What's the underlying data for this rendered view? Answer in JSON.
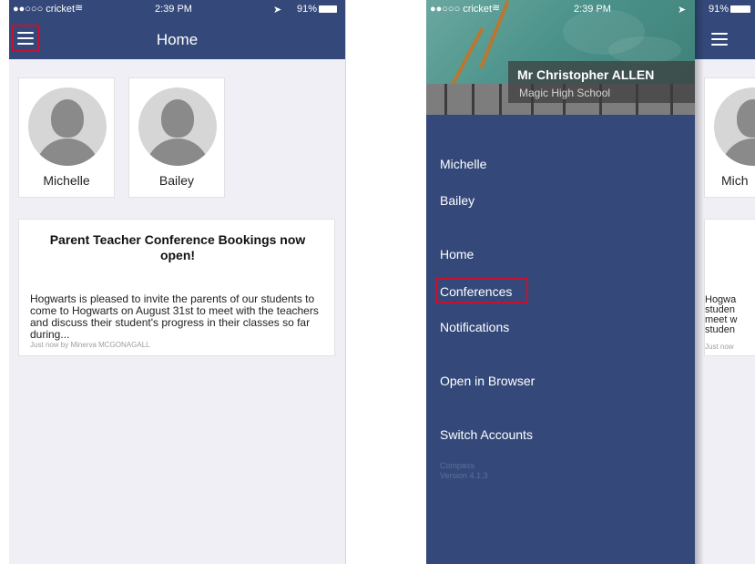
{
  "home_screen": {
    "status": {
      "carrier": "●●○○○ cricket",
      "time": "2:39 PM",
      "battery": "91%"
    },
    "nav_title": "Home",
    "students": [
      {
        "name": "Michelle"
      },
      {
        "name": "Bailey"
      }
    ],
    "news": {
      "title": "Parent Teacher Conference Bookings now open!",
      "body": "Hogwarts is pleased to invite the parents of our students to come to Hogwarts on August 31st to meet with the teachers and discuss their student's progress in their classes so far during...",
      "meta": "Just now by Minerva MCGONAGALL"
    }
  },
  "drawer_screen": {
    "status": {
      "carrier": "●●○○○ cricket",
      "time": "2:39 PM",
      "battery": "91%"
    },
    "profile": {
      "name": "Mr Christopher ALLEN",
      "school": "Magic High School"
    },
    "students": [
      "Michelle",
      "Bailey"
    ],
    "menu": [
      "Home",
      "Conferences",
      "Notifications",
      "Open in Browser",
      "Switch Accounts"
    ],
    "footer": {
      "app": "Compass",
      "version": "Version 4.1.3"
    },
    "background": {
      "student_partial": "Mich",
      "news_partial": [
        "Hogwa",
        "studen",
        "meet w",
        "studen"
      ],
      "meta_partial": "Just now"
    }
  },
  "colors": {
    "primary": "#34497a",
    "highlight": "#c8102e",
    "page_bg": "#f0eff5"
  },
  "icons": [
    "hamburger-icon",
    "wifi-icon",
    "location-icon",
    "battery-icon",
    "avatar-placeholder-icon"
  ]
}
